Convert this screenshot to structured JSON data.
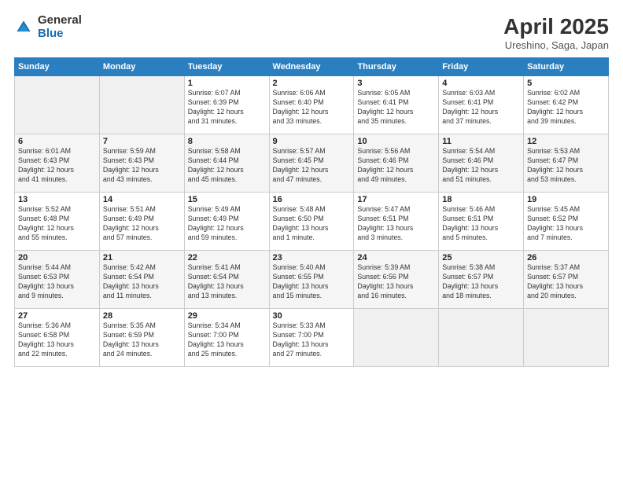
{
  "logo": {
    "general": "General",
    "blue": "Blue"
  },
  "title": "April 2025",
  "subtitle": "Ureshino, Saga, Japan",
  "days_header": [
    "Sunday",
    "Monday",
    "Tuesday",
    "Wednesday",
    "Thursday",
    "Friday",
    "Saturday"
  ],
  "weeks": [
    [
      {
        "num": "",
        "info": "",
        "empty": true
      },
      {
        "num": "",
        "info": "",
        "empty": true
      },
      {
        "num": "1",
        "info": "Sunrise: 6:07 AM\nSunset: 6:39 PM\nDaylight: 12 hours\nand 31 minutes."
      },
      {
        "num": "2",
        "info": "Sunrise: 6:06 AM\nSunset: 6:40 PM\nDaylight: 12 hours\nand 33 minutes."
      },
      {
        "num": "3",
        "info": "Sunrise: 6:05 AM\nSunset: 6:41 PM\nDaylight: 12 hours\nand 35 minutes."
      },
      {
        "num": "4",
        "info": "Sunrise: 6:03 AM\nSunset: 6:41 PM\nDaylight: 12 hours\nand 37 minutes."
      },
      {
        "num": "5",
        "info": "Sunrise: 6:02 AM\nSunset: 6:42 PM\nDaylight: 12 hours\nand 39 minutes."
      }
    ],
    [
      {
        "num": "6",
        "info": "Sunrise: 6:01 AM\nSunset: 6:43 PM\nDaylight: 12 hours\nand 41 minutes."
      },
      {
        "num": "7",
        "info": "Sunrise: 5:59 AM\nSunset: 6:43 PM\nDaylight: 12 hours\nand 43 minutes."
      },
      {
        "num": "8",
        "info": "Sunrise: 5:58 AM\nSunset: 6:44 PM\nDaylight: 12 hours\nand 45 minutes."
      },
      {
        "num": "9",
        "info": "Sunrise: 5:57 AM\nSunset: 6:45 PM\nDaylight: 12 hours\nand 47 minutes."
      },
      {
        "num": "10",
        "info": "Sunrise: 5:56 AM\nSunset: 6:46 PM\nDaylight: 12 hours\nand 49 minutes."
      },
      {
        "num": "11",
        "info": "Sunrise: 5:54 AM\nSunset: 6:46 PM\nDaylight: 12 hours\nand 51 minutes."
      },
      {
        "num": "12",
        "info": "Sunrise: 5:53 AM\nSunset: 6:47 PM\nDaylight: 12 hours\nand 53 minutes."
      }
    ],
    [
      {
        "num": "13",
        "info": "Sunrise: 5:52 AM\nSunset: 6:48 PM\nDaylight: 12 hours\nand 55 minutes."
      },
      {
        "num": "14",
        "info": "Sunrise: 5:51 AM\nSunset: 6:49 PM\nDaylight: 12 hours\nand 57 minutes."
      },
      {
        "num": "15",
        "info": "Sunrise: 5:49 AM\nSunset: 6:49 PM\nDaylight: 12 hours\nand 59 minutes."
      },
      {
        "num": "16",
        "info": "Sunrise: 5:48 AM\nSunset: 6:50 PM\nDaylight: 13 hours\nand 1 minute."
      },
      {
        "num": "17",
        "info": "Sunrise: 5:47 AM\nSunset: 6:51 PM\nDaylight: 13 hours\nand 3 minutes."
      },
      {
        "num": "18",
        "info": "Sunrise: 5:46 AM\nSunset: 6:51 PM\nDaylight: 13 hours\nand 5 minutes."
      },
      {
        "num": "19",
        "info": "Sunrise: 5:45 AM\nSunset: 6:52 PM\nDaylight: 13 hours\nand 7 minutes."
      }
    ],
    [
      {
        "num": "20",
        "info": "Sunrise: 5:44 AM\nSunset: 6:53 PM\nDaylight: 13 hours\nand 9 minutes."
      },
      {
        "num": "21",
        "info": "Sunrise: 5:42 AM\nSunset: 6:54 PM\nDaylight: 13 hours\nand 11 minutes."
      },
      {
        "num": "22",
        "info": "Sunrise: 5:41 AM\nSunset: 6:54 PM\nDaylight: 13 hours\nand 13 minutes."
      },
      {
        "num": "23",
        "info": "Sunrise: 5:40 AM\nSunset: 6:55 PM\nDaylight: 13 hours\nand 15 minutes."
      },
      {
        "num": "24",
        "info": "Sunrise: 5:39 AM\nSunset: 6:56 PM\nDaylight: 13 hours\nand 16 minutes."
      },
      {
        "num": "25",
        "info": "Sunrise: 5:38 AM\nSunset: 6:57 PM\nDaylight: 13 hours\nand 18 minutes."
      },
      {
        "num": "26",
        "info": "Sunrise: 5:37 AM\nSunset: 6:57 PM\nDaylight: 13 hours\nand 20 minutes."
      }
    ],
    [
      {
        "num": "27",
        "info": "Sunrise: 5:36 AM\nSunset: 6:58 PM\nDaylight: 13 hours\nand 22 minutes."
      },
      {
        "num": "28",
        "info": "Sunrise: 5:35 AM\nSunset: 6:59 PM\nDaylight: 13 hours\nand 24 minutes."
      },
      {
        "num": "29",
        "info": "Sunrise: 5:34 AM\nSunset: 7:00 PM\nDaylight: 13 hours\nand 25 minutes."
      },
      {
        "num": "30",
        "info": "Sunrise: 5:33 AM\nSunset: 7:00 PM\nDaylight: 13 hours\nand 27 minutes."
      },
      {
        "num": "",
        "info": "",
        "empty": true
      },
      {
        "num": "",
        "info": "",
        "empty": true
      },
      {
        "num": "",
        "info": "",
        "empty": true
      }
    ]
  ]
}
